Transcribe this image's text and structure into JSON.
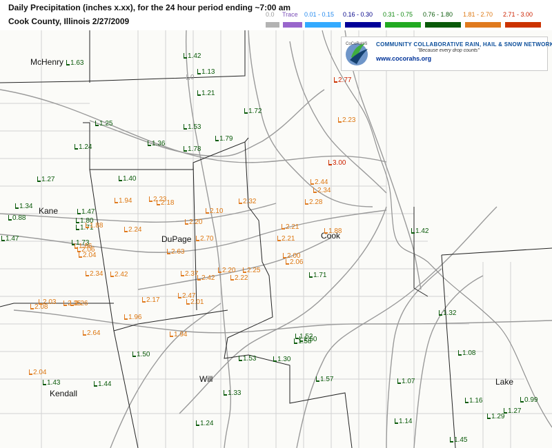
{
  "header": {
    "title": "Daily Precipitation (inches  x.xx),   for the 24 hour period ending ~7:00 am",
    "subtitle": "Cook County, Illinois  2/27/2009"
  },
  "legend": [
    {
      "label": "0.0",
      "color": "#b3b3b3",
      "text_color": "#999999"
    },
    {
      "label": "Trace",
      "color": "#9966cc",
      "text_color": "#7b4fb8"
    },
    {
      "label": "0.01 - 0.15",
      "color": "#33aaff",
      "text_color": "#2288ee"
    },
    {
      "label": "0.16 - 0.30",
      "color": "#000099",
      "text_color": "#000088"
    },
    {
      "label": "0.31 - 0.75",
      "color": "#22aa22",
      "text_color": "#118811"
    },
    {
      "label": "0.76 - 1.80",
      "color": "#0a5a0a",
      "text_color": "#0a5a0a"
    },
    {
      "label": "1.81 - 2.70",
      "color": "#e07a1e",
      "text_color": "#dd7711"
    },
    {
      "label": "2.71 - 3.00",
      "color": "#cc3300",
      "text_color": "#cc2200"
    }
  ],
  "counties": [
    {
      "name": "McHenry"
    },
    {
      "name": "Kane"
    },
    {
      "name": "DuPage"
    },
    {
      "name": "Cook"
    },
    {
      "name": "Will"
    },
    {
      "name": "Kendall"
    },
    {
      "name": "Lake"
    }
  ],
  "observations": [
    {
      "value": "1.63",
      "cat": 5
    },
    {
      "value": "1.42",
      "cat": 5
    },
    {
      "value": "1.13",
      "cat": 5
    },
    {
      "value": "0",
      "cat": 0
    },
    {
      "value": "1.21",
      "cat": 5
    },
    {
      "value": "1.72",
      "cat": 5
    },
    {
      "value": "1.25",
      "cat": 5
    },
    {
      "value": "1.53",
      "cat": 5
    },
    {
      "value": "1.79",
      "cat": 5
    },
    {
      "value": "1.24",
      "cat": 5
    },
    {
      "value": "1.36",
      "cat": 5
    },
    {
      "value": "1.78",
      "cat": 5
    },
    {
      "value": "1.27",
      "cat": 5
    },
    {
      "value": "1.40",
      "cat": 5
    },
    {
      "value": "1.34",
      "cat": 5
    },
    {
      "value": "0.88",
      "cat": 5
    },
    {
      "value": "1.47",
      "cat": 5
    },
    {
      "value": "1.80",
      "cat": 5
    },
    {
      "value": "1.71",
      "cat": 5
    },
    {
      "value": "1.47",
      "cat": 5
    },
    {
      "value": "1.73",
      "cat": 5
    },
    {
      "value": "1.94",
      "cat": 6
    },
    {
      "value": "2.23",
      "cat": 6
    },
    {
      "value": "2.18",
      "cat": 6
    },
    {
      "value": "2.10",
      "cat": 6
    },
    {
      "value": "2.32",
      "cat": 6
    },
    {
      "value": "1.88",
      "cat": 6
    },
    {
      "value": "2.24",
      "cat": 6
    },
    {
      "value": "2.20",
      "cat": 6
    },
    {
      "value": "2.70",
      "cat": 6
    },
    {
      "value": "1.86",
      "cat": 6
    },
    {
      "value": "2.06",
      "cat": 6
    },
    {
      "value": "2.04",
      "cat": 6
    },
    {
      "value": "2.63",
      "cat": 6
    },
    {
      "value": "2.34",
      "cat": 6
    },
    {
      "value": "2.42",
      "cat": 6
    },
    {
      "value": "2.37",
      "cat": 6
    },
    {
      "value": "2.42",
      "cat": 6
    },
    {
      "value": "2.20",
      "cat": 6
    },
    {
      "value": "2.25",
      "cat": 6
    },
    {
      "value": "2.22",
      "cat": 6
    },
    {
      "value": "2.47",
      "cat": 6
    },
    {
      "value": "2.17",
      "cat": 6
    },
    {
      "value": "2.01",
      "cat": 6
    },
    {
      "value": "2.03",
      "cat": 6
    },
    {
      "value": "2.08",
      "cat": 6
    },
    {
      "value": "2.35",
      "cat": 6
    },
    {
      "value": "2.26",
      "cat": 6
    },
    {
      "value": "1.96",
      "cat": 6
    },
    {
      "value": "2.64",
      "cat": 6
    },
    {
      "value": "1.94",
      "cat": 6
    },
    {
      "value": "2.04",
      "cat": 6
    },
    {
      "value": "2.77",
      "cat": 7
    },
    {
      "value": "2.23",
      "cat": 6
    },
    {
      "value": "3.00",
      "cat": 7
    },
    {
      "value": "2.44",
      "cat": 6
    },
    {
      "value": "2.34",
      "cat": 6
    },
    {
      "value": "2.28",
      "cat": 6
    },
    {
      "value": "2.21",
      "cat": 6
    },
    {
      "value": "2.21",
      "cat": 6
    },
    {
      "value": "1.88",
      "cat": 6
    },
    {
      "value": "2.00",
      "cat": 6
    },
    {
      "value": "2.06",
      "cat": 6
    },
    {
      "value": "1.71",
      "cat": 5
    },
    {
      "value": "1.42",
      "cat": 5
    },
    {
      "value": "1.50",
      "cat": 5
    },
    {
      "value": "1.52",
      "cat": 5
    },
    {
      "value": "1.50",
      "cat": 5
    },
    {
      "value": "1.58",
      "cat": 5
    },
    {
      "value": "1.53",
      "cat": 5
    },
    {
      "value": "1.30",
      "cat": 5
    },
    {
      "value": "1.57",
      "cat": 5
    },
    {
      "value": "1.43",
      "cat": 5
    },
    {
      "value": "1.44",
      "cat": 5
    },
    {
      "value": "1.33",
      "cat": 5
    },
    {
      "value": "1.24",
      "cat": 5
    },
    {
      "value": "1.07",
      "cat": 5
    },
    {
      "value": "1.14",
      "cat": 5
    },
    {
      "value": "1.32",
      "cat": 5
    },
    {
      "value": "1.08",
      "cat": 5
    },
    {
      "value": "1.16",
      "cat": 5
    },
    {
      "value": "1.29",
      "cat": 5
    },
    {
      "value": "1.27",
      "cat": 5
    },
    {
      "value": "0.99",
      "cat": 5
    },
    {
      "value": "1.45",
      "cat": 5
    }
  ],
  "logo": {
    "name": "COMMUNITY COLLABORATIVE RAIN, HAIL & SNOW NETWORK",
    "tagline": "\"Because every drop counts\"",
    "url": "www.cocorahs.org",
    "icon": "cocorahs-raindrop-logo"
  }
}
